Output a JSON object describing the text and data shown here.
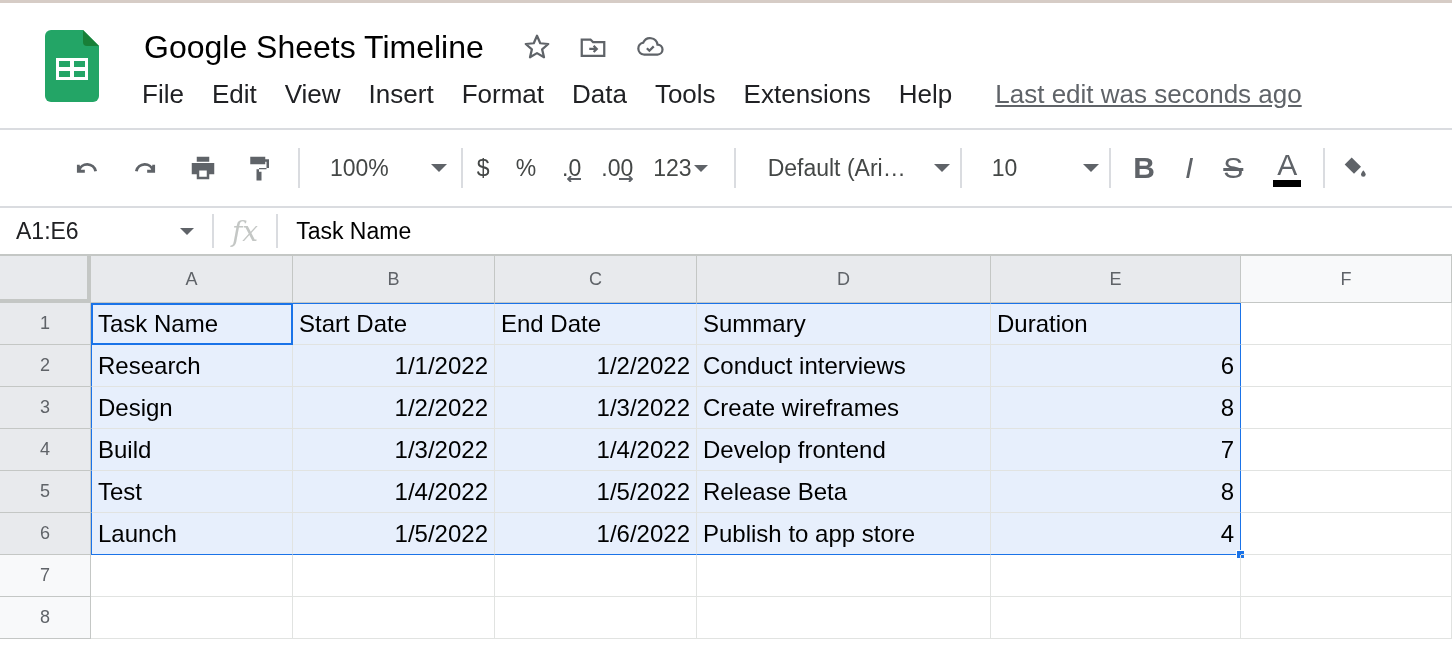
{
  "document": {
    "title": "Google Sheets Timeline"
  },
  "menu": [
    "File",
    "Edit",
    "View",
    "Insert",
    "Format",
    "Data",
    "Tools",
    "Extensions",
    "Help"
  ],
  "last_edit": "Last edit was seconds ago",
  "toolbar": {
    "zoom": "100%",
    "currency": "$",
    "percent": "%",
    "decrease_decimals": ".0",
    "increase_decimals": ".00",
    "number_format": "123",
    "font": "Default (Ari…",
    "font_size": "10",
    "bold": "B",
    "italic": "I",
    "strikethrough": "S",
    "text_color": "A"
  },
  "formula_bar": {
    "name_box": "A1:E6",
    "fx": "fx",
    "value": "Task Name"
  },
  "columns": [
    {
      "label": "A",
      "kind": "text",
      "selected": true
    },
    {
      "label": "B",
      "kind": "number",
      "selected": true
    },
    {
      "label": "C",
      "kind": "number",
      "selected": true
    },
    {
      "label": "D",
      "kind": "text",
      "selected": true
    },
    {
      "label": "E",
      "kind": "number",
      "selected": true
    },
    {
      "label": "F",
      "kind": "text",
      "selected": false
    }
  ],
  "rows": [
    {
      "number": "1",
      "selected": true,
      "cells": [
        {
          "text": "Task Name",
          "active": true
        },
        {
          "text": "Start Date",
          "active": false
        },
        {
          "text": "End Date",
          "active": false
        },
        {
          "text": "Summary",
          "active": false
        },
        {
          "text": "Duration",
          "active": false
        }
      ]
    },
    {
      "number": "2",
      "selected": true,
      "cells": [
        {
          "text": "Research",
          "active": false
        },
        {
          "text": "1/1/2022",
          "active": false
        },
        {
          "text": "1/2/2022",
          "active": false
        },
        {
          "text": "Conduct interviews",
          "active": false
        },
        {
          "text": "6",
          "active": false
        }
      ]
    },
    {
      "number": "3",
      "selected": true,
      "cells": [
        {
          "text": "Design",
          "active": false
        },
        {
          "text": "1/2/2022",
          "active": false
        },
        {
          "text": "1/3/2022",
          "active": false
        },
        {
          "text": "Create wireframes",
          "active": false
        },
        {
          "text": "8",
          "active": false
        }
      ]
    },
    {
      "number": "4",
      "selected": true,
      "cells": [
        {
          "text": "Build",
          "active": false
        },
        {
          "text": "1/3/2022",
          "active": false
        },
        {
          "text": "1/4/2022",
          "active": false
        },
        {
          "text": "Develop frontend",
          "active": false
        },
        {
          "text": "7",
          "active": false
        }
      ]
    },
    {
      "number": "5",
      "selected": true,
      "cells": [
        {
          "text": "Test",
          "active": false
        },
        {
          "text": "1/4/2022",
          "active": false
        },
        {
          "text": "1/5/2022",
          "active": false
        },
        {
          "text": "Release Beta",
          "active": false
        },
        {
          "text": "8",
          "active": false
        }
      ]
    },
    {
      "number": "6",
      "selected": true,
      "cells": [
        {
          "text": "Launch",
          "active": false
        },
        {
          "text": "1/5/2022",
          "active": false
        },
        {
          "text": "1/6/2022",
          "active": false
        },
        {
          "text": "Publish to app store",
          "active": false
        },
        {
          "text": "4",
          "active": false
        }
      ]
    },
    {
      "number": "7",
      "selected": false,
      "cells": []
    },
    {
      "number": "8",
      "selected": false,
      "cells": []
    }
  ]
}
